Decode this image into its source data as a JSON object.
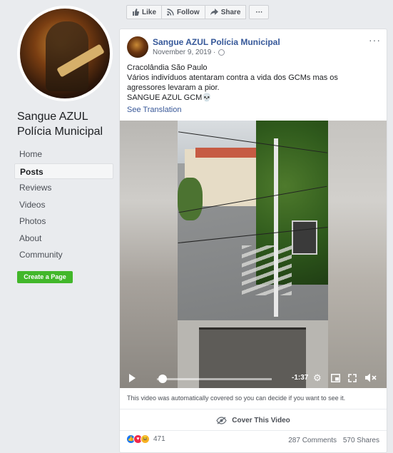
{
  "sidebar": {
    "page_name": "Sangue AZUL Polícia Municipal",
    "nav": [
      "Home",
      "Posts",
      "Reviews",
      "Videos",
      "Photos",
      "About",
      "Community"
    ],
    "active_index": 1,
    "create_page": "Create a Page"
  },
  "actions": {
    "like": "Like",
    "follow": "Follow",
    "share": "Share",
    "more": "···"
  },
  "post": {
    "author": "Sangue AZUL Polícia Municipal",
    "date": "November 9, 2019 · ",
    "more": "···",
    "text_lines": [
      "Cracolândia São Paulo",
      "Vários indivíduos atentaram contra a vida dos GCMs mas os agressores levaram a pior.",
      "SANGUE AZUL GCM💀"
    ],
    "see_translation": "See Translation",
    "video": {
      "time": "-1:37",
      "progress": 0.05
    },
    "notice": "This video was automatically covered so you can decide if you want to see it.",
    "cover": "Cover This Video",
    "reaction_count": "471",
    "comments": "287 Comments",
    "shares": "570 Shares"
  },
  "colors": {
    "link": "#365899",
    "create_button": "#42b72a",
    "background": "#e9ebee"
  }
}
